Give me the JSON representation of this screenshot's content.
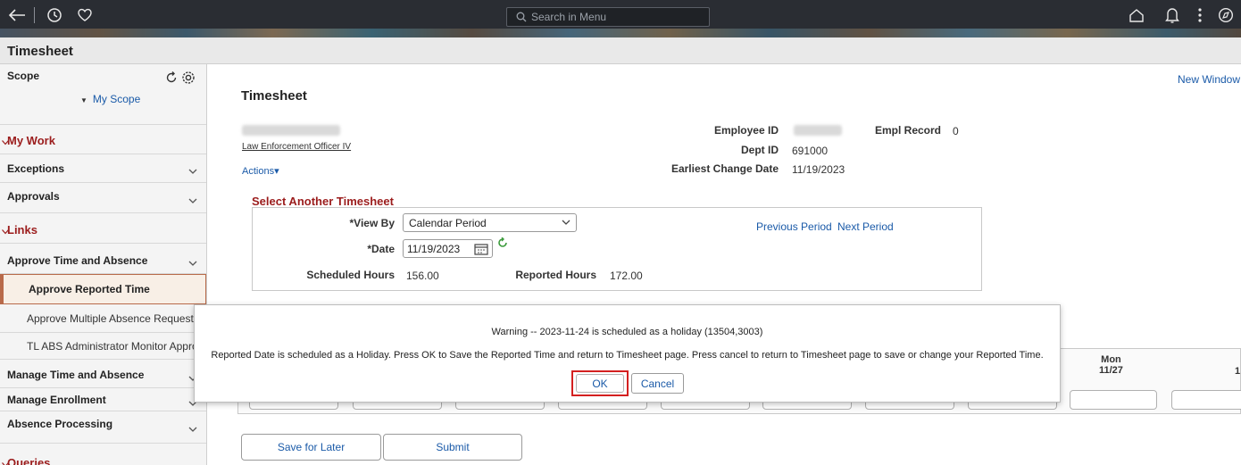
{
  "topbar": {
    "search_placeholder": "Search in Menu",
    "icons": [
      "back-arrow-icon",
      "history-icon",
      "favorites-heart-icon",
      "home-icon",
      "notifications-bell-icon",
      "actions-menu-icon",
      "navbar-compass-icon"
    ]
  },
  "page_title": "Timesheet",
  "sidebar": {
    "scope_label": "Scope",
    "my_scope": "My Scope",
    "sections": [
      {
        "label": "My Work",
        "type": "header"
      },
      {
        "label": "Exceptions",
        "type": "item"
      },
      {
        "label": "Approvals",
        "type": "item"
      },
      {
        "label": "Links",
        "type": "header"
      },
      {
        "label": "Approve Time and Absence",
        "type": "item"
      },
      {
        "label": "Approve Reported Time",
        "type": "sub-selected"
      },
      {
        "label": "Approve Multiple Absence Requests",
        "type": "sub"
      },
      {
        "label": "TL ABS Administrator Monitor Approv",
        "type": "sub"
      },
      {
        "label": "Manage Time and Absence",
        "type": "item"
      },
      {
        "label": "Manage Enrollment",
        "type": "item"
      },
      {
        "label": "Absence Processing",
        "type": "item"
      },
      {
        "label": "Queries",
        "type": "header"
      }
    ]
  },
  "main": {
    "new_window": "New Window",
    "title": "Timesheet",
    "job_title": "Law Enforcement Officer IV",
    "actions": "Actions",
    "employee_id_label": "Employee ID",
    "empl_record_label": "Empl Record",
    "empl_record_value": "0",
    "dept_id_label": "Dept ID",
    "dept_id_value": "691000",
    "earliest_change_label": "Earliest Change Date",
    "earliest_change_value": "11/19/2023",
    "select_heading": "Select Another Timesheet",
    "view_by_label": "*View By",
    "view_by_value": "Calendar Period",
    "date_label": "*Date",
    "date_value": "11/19/2023",
    "previous_period": "Previous Period",
    "next_period": "Next Period",
    "scheduled_hours_label": "Scheduled Hours",
    "scheduled_hours_value": "156.00",
    "reported_hours_label": "Reported Hours",
    "reported_hours_value": "172.00",
    "mon_day": "Mon",
    "mon_date": "11/27",
    "col_partial": "1",
    "save_for_later": "Save for Later",
    "submit": "Submit"
  },
  "dialog": {
    "title": "Warning -- 2023-11-24 is scheduled as  a holiday (13504,3003)",
    "message": "Reported Date is scheduled as a Holiday. Press OK to Save the Reported Time and return to Timesheet page. Press cancel to return to Timesheet page to save or change your Reported Time.",
    "ok": "OK",
    "cancel": "Cancel"
  }
}
